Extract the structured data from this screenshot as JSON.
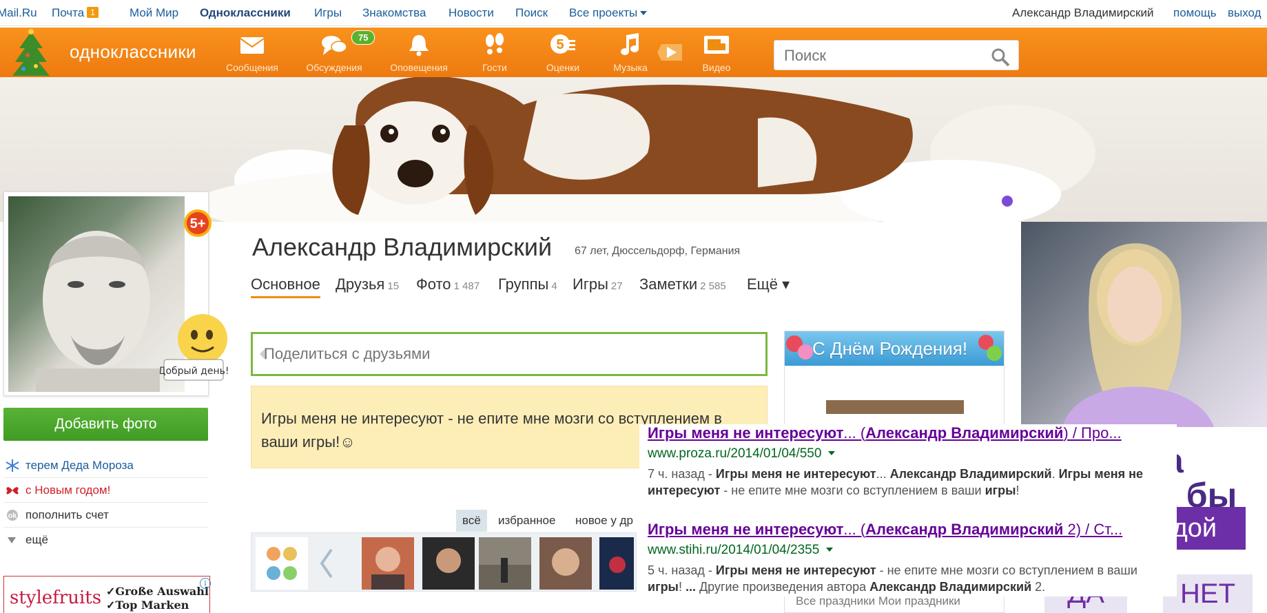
{
  "topbar": {
    "mailru": "Mail.Ru",
    "pochta": "Почта",
    "pochta_badge": "1",
    "moimir": "Мой Мир",
    "ok": "Одноклассники",
    "igry": "Игры",
    "znakomstva": "Знакомства",
    "novosti": "Новости",
    "poisk": "Поиск",
    "vse_proekty": "Все проекты",
    "user": "Александр Владимирский",
    "help": "помощь",
    "logout": "выход"
  },
  "header": {
    "brand": "одноклассники",
    "nav": [
      {
        "label": "Сообщения"
      },
      {
        "label": "Обсуждения",
        "badge": "75"
      },
      {
        "label": "Оповещения"
      },
      {
        "label": "Гости"
      },
      {
        "label": "Оценки"
      },
      {
        "label": "Музыка"
      },
      {
        "label": "Видео"
      }
    ],
    "search_placeholder": "Поиск",
    "accent": "#f08c10"
  },
  "left": {
    "add_photo": "Добавить фото",
    "links": [
      "терем Деда Мороза",
      "с Новым годом!",
      "пополнить счет",
      "ещё"
    ],
    "ad_brand": "stylefruits",
    "ad_lines": [
      "✓Große Auswahl",
      "✓Top Marken"
    ]
  },
  "profile": {
    "name": "Александр Владимирский",
    "info": "67 лет, Дюссельдорф, Германия",
    "tabs": [
      {
        "label": "Основное",
        "count": ""
      },
      {
        "label": "Друзья",
        "count": "15"
      },
      {
        "label": "Фото",
        "count": "1 487"
      },
      {
        "label": "Группы",
        "count": "4"
      },
      {
        "label": "Игры",
        "count": "27"
      },
      {
        "label": "Заметки",
        "count": "2 585"
      },
      {
        "label": "Ещё ▾",
        "count": ""
      }
    ],
    "share_placeholder": "Поделиться с друзьями",
    "status": "Игры меня не интересуют - не епите мне мозги со вступлением в ваши игры!☺",
    "filters": [
      "всё",
      "избранное",
      "новое у др"
    ]
  },
  "birthday": {
    "title": "С Днём Рождения!",
    "links": "Все праздники   Мои праздники"
  },
  "ad": {
    "text1": "а",
    "text2": "а бы",
    "btn": "вдой",
    "yes": "ДА",
    "no": "НЕТ"
  },
  "results": [
    {
      "title_pre": "Игры меня не интересуют",
      "title_mid": "... (",
      "title_bold": "Александр Владимирский",
      "title_post": ") / Про...",
      "url": "www.proza.ru/2014/01/04/550",
      "snippet": "7 ч. назад - <b>Игры меня не интересуют</b>... <b>Александр Владимирский</b>. <b>Игры меня не интересуют</b> - не епите мне мозги со вступлением в ваши <b>игры</b>!"
    },
    {
      "title_pre": "Игры меня не интересуют",
      "title_mid": "... (",
      "title_bold": "Александр Владимирский",
      "title_post": " 2) / Ст...",
      "url": "www.stihi.ru/2014/01/04/2355",
      "snippet": "5 ч. назад - <b>Игры меня не интересуют</b> - не епите мне мозги со вступлением в ваши <b>игры</b>! <b>...</b> Другие произведения автора <b>Александр Владимирский</b> 2."
    }
  ]
}
